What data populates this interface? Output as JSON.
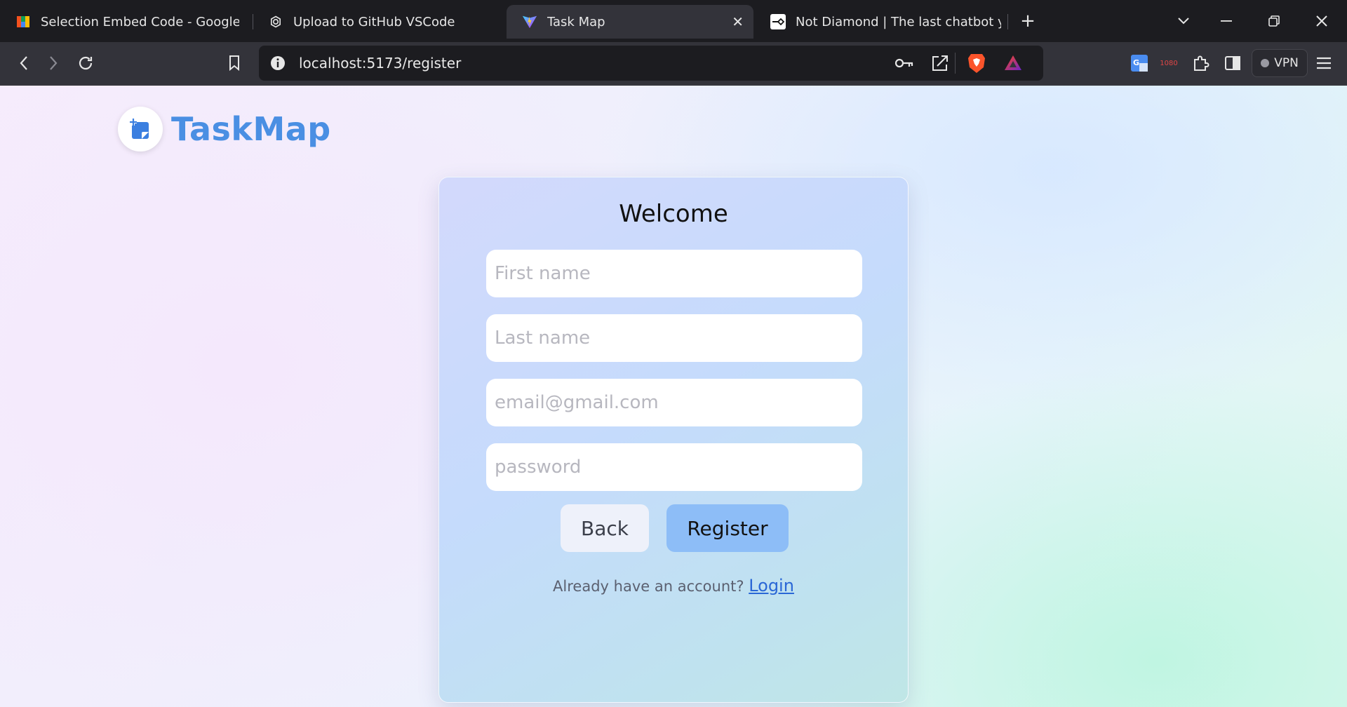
{
  "browser": {
    "tabs": [
      {
        "title": "Selection Embed Code - Google For",
        "icon": "google-forms-icon",
        "active": false
      },
      {
        "title": "Upload to GitHub VSCode",
        "icon": "chatgpt-icon",
        "active": false
      },
      {
        "title": "Task Map",
        "icon": "vite-icon",
        "active": true
      },
      {
        "title": "Not Diamond | The last chatbot you",
        "icon": "not-diamond-icon",
        "active": false
      }
    ],
    "url_host": "localhost",
    "url_path": ":5173/register",
    "vpn_label": "VPN",
    "extension_badge": "1080"
  },
  "app": {
    "brand_name": "TaskMap",
    "brand_color": "#4a8fe3"
  },
  "register": {
    "title": "Welcome",
    "first_name_placeholder": "First name",
    "last_name_placeholder": "Last name",
    "email_placeholder": "email@gmail.com",
    "password_placeholder": "password",
    "back_label": "Back",
    "register_label": "Register",
    "footer_text": "Already have an account? ",
    "login_link": "Login"
  }
}
